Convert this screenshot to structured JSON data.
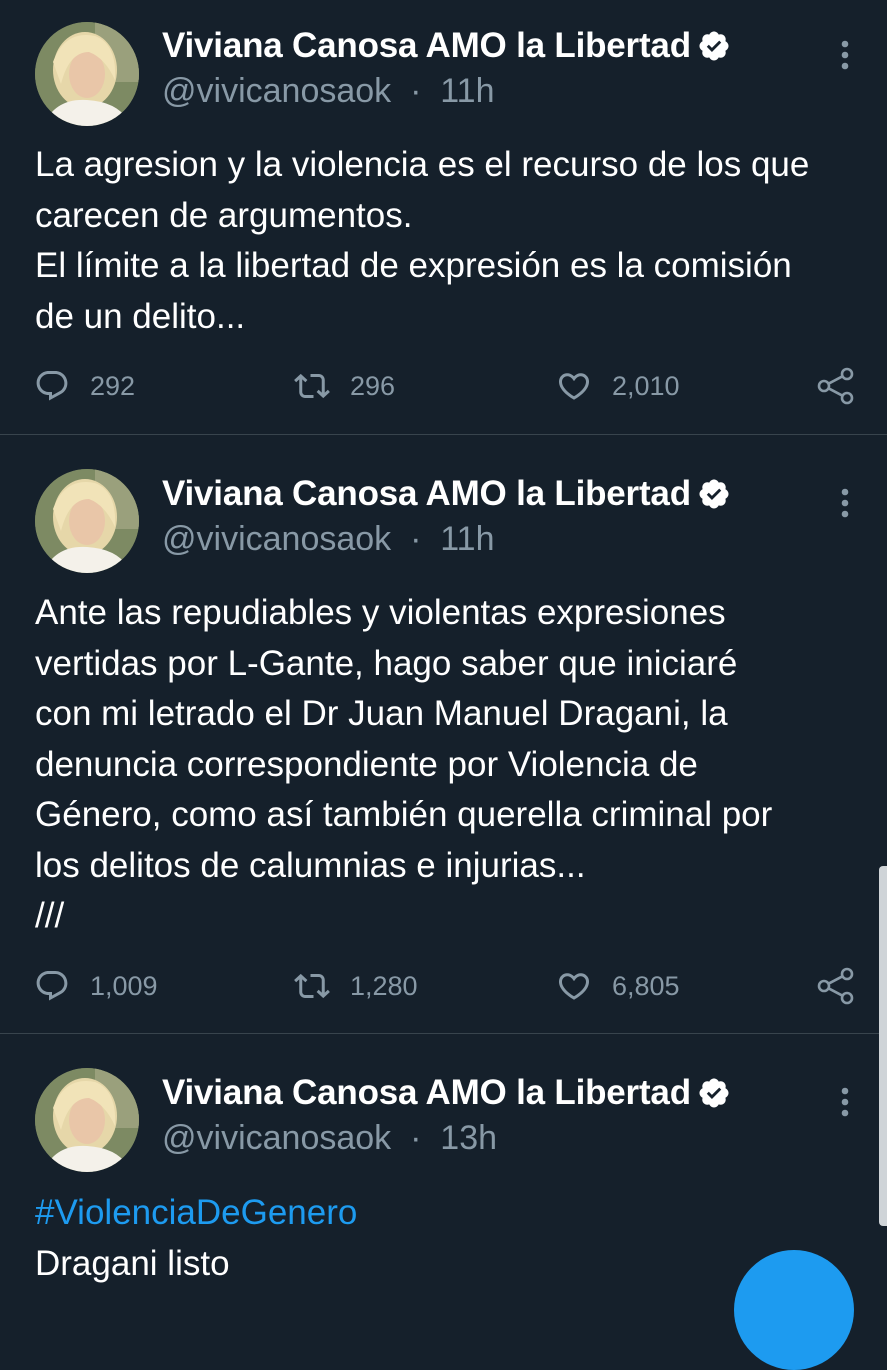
{
  "tweets": [
    {
      "author": "Viviana Canosa AMO la Libertad",
      "handle": "@vivicanosaok",
      "separator": "·",
      "time": "11h",
      "lines": [
        "La agresion y la violencia es el recurso de los que",
        "carecen de argumentos.",
        "El límite a la libertad de expresión es la comisión",
        "de un delito..."
      ],
      "replies": "292",
      "retweets": "296",
      "likes": "2,010"
    },
    {
      "author": "Viviana Canosa AMO la Libertad",
      "handle": "@vivicanosaok",
      "separator": "·",
      "time": "11h",
      "lines": [
        "Ante las repudiables y violentas expresiones",
        "vertidas por L-Gante, hago saber que iniciaré",
        "con mi letrado el Dr Juan Manuel Dragani, la",
        "denuncia correspondiente por Violencia de",
        "Género, como así también querella criminal  por",
        "los delitos de calumnias e injurias...",
        "///"
      ],
      "replies": "1,009",
      "retweets": "1,280",
      "likes": "6,805"
    },
    {
      "author": "Viviana Canosa AMO la Libertad",
      "handle": "@vivicanosaok",
      "separator": "·",
      "time": "13h",
      "hashtag": "#ViolenciaDeGenero",
      "lines": [
        "Dragani listo"
      ]
    }
  ],
  "icons": {
    "reply": "reply-icon",
    "retweet": "retweet-icon",
    "like": "heart-icon",
    "share": "share-icon",
    "verified": "verified-badge-icon",
    "more": "more-vertical-icon",
    "compose": "compose-tweet-fab"
  },
  "colors": {
    "background": "#15202b",
    "text": "#ffffff",
    "secondary": "#8899a6",
    "accent": "#1d9bf0",
    "divider": "#38444d"
  }
}
